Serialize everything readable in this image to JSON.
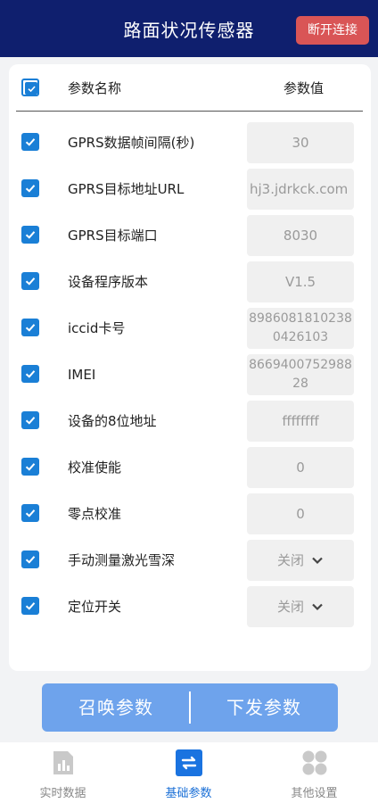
{
  "header": {
    "title": "路面状况传感器",
    "disconnect_label": "断开连接"
  },
  "table": {
    "col_name": "参数名称",
    "col_value": "参数值"
  },
  "rows": [
    {
      "label": "GPRS数据帧间隔(秒)",
      "value": "30"
    },
    {
      "label": "GPRS目标地址URL",
      "value": "hj3.jdrkck.com"
    },
    {
      "label": "GPRS目标端口",
      "value": "8030"
    },
    {
      "label": "设备程序版本",
      "value": "V1.5"
    },
    {
      "label": "iccid卡号",
      "value": "89860818102380426103"
    },
    {
      "label": "IMEI",
      "value": "866940075298828"
    },
    {
      "label": "设备的8位地址",
      "value": "ffffffff"
    },
    {
      "label": "校准使能",
      "value": "0"
    },
    {
      "label": "零点校准",
      "value": "0"
    },
    {
      "label": "手动测量激光雪深",
      "value": "关闭"
    },
    {
      "label": "定位开关",
      "value": "关闭"
    }
  ],
  "actions": {
    "summon_label": "召唤参数",
    "send_label": "下发参数"
  },
  "tabs": [
    {
      "label": "实时数据",
      "icon": "bar-chart-icon"
    },
    {
      "label": "基础参数",
      "icon": "sync-icon"
    },
    {
      "label": "其他设置",
      "icon": "grid-icon"
    }
  ],
  "colors": {
    "header": "#0f1f6e",
    "accent": "#1a7fd6",
    "button": "#6ea3ec",
    "danger": "#d95556"
  }
}
